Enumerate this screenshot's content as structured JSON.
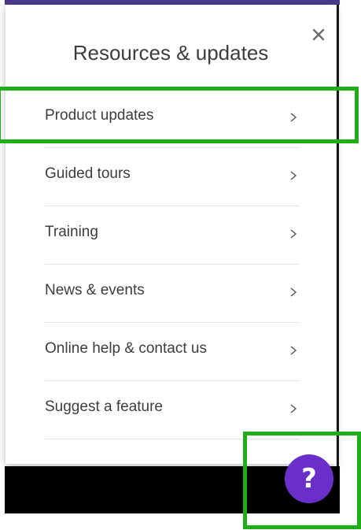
{
  "panel": {
    "title": "Resources & updates",
    "close_icon": "close-icon",
    "items": [
      {
        "label": "Product updates",
        "icon": "chevron-right-icon"
      },
      {
        "label": "Guided tours",
        "icon": "chevron-right-icon"
      },
      {
        "label": "Training",
        "icon": "chevron-right-icon"
      },
      {
        "label": "News & events",
        "icon": "chevron-right-icon"
      },
      {
        "label": "Online help & contact us",
        "icon": "chevron-right-icon"
      },
      {
        "label": "Suggest a feature",
        "icon": "chevron-right-icon"
      }
    ]
  },
  "help_button": {
    "glyph": "?",
    "color": "#6a2fc9"
  },
  "colors": {
    "highlight": "#1fae18",
    "header_strip": "#4b3a8c",
    "text": "#3d3d3d"
  }
}
